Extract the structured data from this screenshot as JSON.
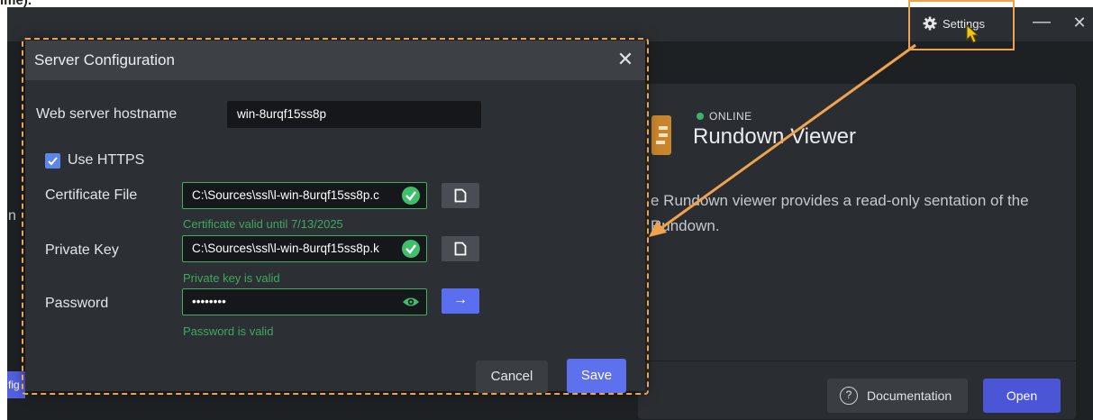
{
  "top_fragment": "ime).",
  "window": {
    "settings_label": "Settings",
    "minimize_glyph": "—",
    "close_glyph": "✕"
  },
  "app_card": {
    "status": "ONLINE",
    "title": "Rundown Viewer",
    "description": "e Rundown viewer provides a read-only sentation of the Rundown.",
    "documentation_label": "Documentation",
    "open_label": "Open"
  },
  "left_fragments": {
    "n": "n",
    "fig": "fig"
  },
  "dialog": {
    "title": "Server Configuration",
    "hostname_label": "Web server hostname",
    "hostname_value": "win-8urqf15ss8p",
    "use_https_label": "Use HTTPS",
    "use_https_checked": true,
    "certificate_label": "Certificate File",
    "certificate_value": "C:\\Sources\\ssl\\l-win-8urqf15ss8p.c",
    "certificate_hint": "Certificate valid until 7/13/2025",
    "private_key_label": "Private Key",
    "private_key_value": "C:\\Sources\\ssl\\l-win-8urqf15ss8p.k",
    "private_key_hint": "Private key is valid",
    "password_label": "Password",
    "password_value": "••••••••",
    "password_hint": "Password is valid",
    "cancel_label": "Cancel",
    "save_label": "Save"
  },
  "colors": {
    "annotation": "#f0a34e",
    "valid": "#3fae5f",
    "primary": "#5d70ee"
  }
}
